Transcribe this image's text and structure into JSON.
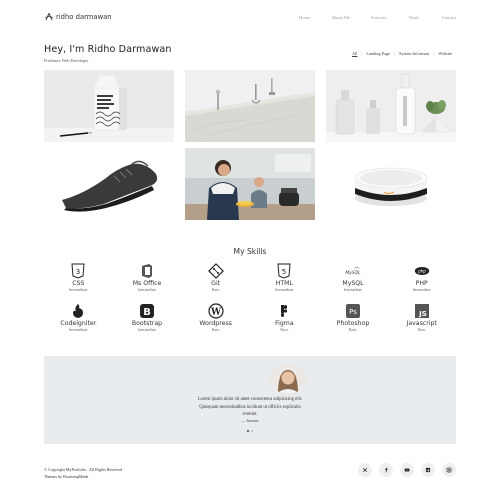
{
  "brand": {
    "name": "ridho darmawan"
  },
  "nav": {
    "items": [
      "Home",
      "About Me",
      "Services",
      "Work",
      "Contact"
    ]
  },
  "hero": {
    "title": "Hey, I'm Ridho Darmawan",
    "subtitle": "Freelance Web Developer"
  },
  "filters": {
    "items": [
      "All",
      "Landing Page",
      "System Informasi",
      "Website"
    ],
    "active": "All"
  },
  "portfolio": {
    "tiles": [
      {
        "label": "portfolio-item-milk-carton"
      },
      {
        "label": "portfolio-item-kitchen-utensils"
      },
      {
        "label": "portfolio-item-cosmetic-bottles"
      },
      {
        "label": "portfolio-item-sneaker"
      },
      {
        "label": "portfolio-item-people-cooking"
      },
      {
        "label": "portfolio-item-smart-speaker"
      }
    ]
  },
  "skills": {
    "title": "My Skills",
    "items": [
      {
        "name": "CSS",
        "level": "Intermediate",
        "icon": "css3-icon"
      },
      {
        "name": "Ms Office",
        "level": "Intermediate",
        "icon": "ms-office-icon"
      },
      {
        "name": "Git",
        "level": "Basic",
        "icon": "git-icon"
      },
      {
        "name": "HTML",
        "level": "Intermediate",
        "icon": "html5-icon"
      },
      {
        "name": "MySQL",
        "level": "Intermediate",
        "icon": "mysql-icon"
      },
      {
        "name": "PHP",
        "level": "Intermediate",
        "icon": "php-icon"
      },
      {
        "name": "Codelgniter",
        "level": "Intermediate",
        "icon": "codeigniter-icon"
      },
      {
        "name": "Bootstrap",
        "level": "Intermediate",
        "icon": "bootstrap-icon"
      },
      {
        "name": "Wordpress",
        "level": "Basic",
        "icon": "wordpress-icon"
      },
      {
        "name": "Figma",
        "level": "Basic",
        "icon": "figma-icon"
      },
      {
        "name": "Photoshop",
        "level": "Basic",
        "icon": "photoshop-icon"
      },
      {
        "name": "Javascript",
        "level": "Basic",
        "icon": "javascript-icon"
      }
    ]
  },
  "testimonial": {
    "text_line1": "Lorem ipsum dolor sit amet consectetur adipisicing elit.",
    "text_line2": "Quisquam necessitatibus incidunt ut officiis explicabo",
    "text_line3": "eveniet.",
    "author": "— Jasmine"
  },
  "footer": {
    "copyright": "© Copyright MyPortfolio . All Rights Reserved",
    "theme": "Themes by BootstrapMade"
  },
  "socials": [
    "twitter-icon",
    "facebook-icon",
    "youtube-icon",
    "linkedin-icon",
    "instagram-icon"
  ]
}
